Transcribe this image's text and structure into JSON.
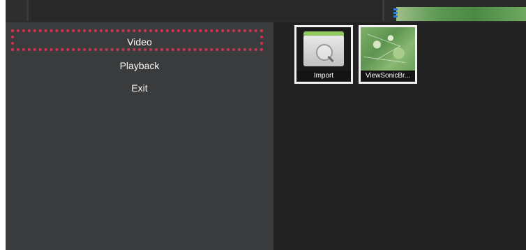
{
  "menu": {
    "items": [
      {
        "label": "Video",
        "selected": true
      },
      {
        "label": "Playback",
        "selected": false
      },
      {
        "label": "Exit",
        "selected": false
      }
    ]
  },
  "content": {
    "tiles": [
      {
        "caption": "Import",
        "icon": "folder-search-icon"
      },
      {
        "caption": "ViewSonicBr...",
        "icon": "map-thumbnail"
      }
    ]
  },
  "colors": {
    "focus_frame": "#d4324e",
    "menu_panel": "#3a3b3c",
    "content_bg": "#222222"
  }
}
